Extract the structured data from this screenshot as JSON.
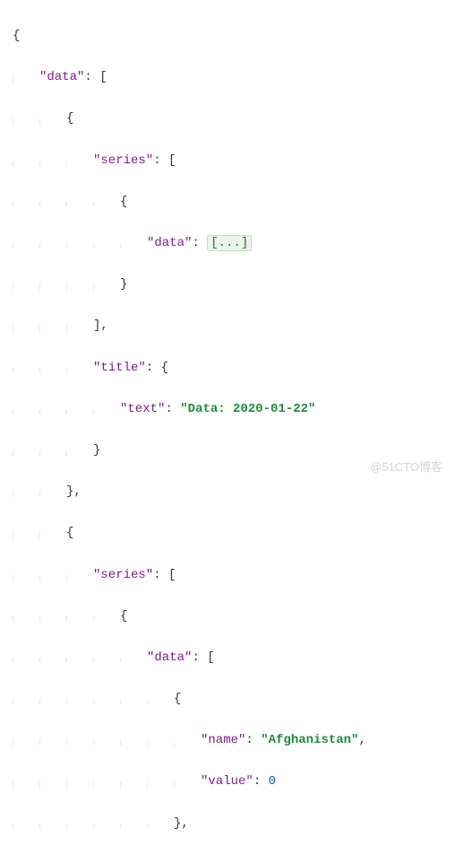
{
  "keys": {
    "data": "\"data\"",
    "series": "\"series\"",
    "title": "\"title\"",
    "text": "\"text\"",
    "name": "\"name\"",
    "value": "\"value\""
  },
  "vals": {
    "date": "\"Data: 2020-01-22\"",
    "afghanistan": "\"Afghanistan\"",
    "zero": "0"
  },
  "punct": {
    "open_brace": "{",
    "close_brace": "}",
    "open_bracket": "[",
    "close_bracket": "]",
    "colon_sp": ": ",
    "comma": ",",
    "close_brace_comma": "},",
    "close_br_comma": "],"
  },
  "fold": "[...]",
  "watermark": "@51CTO博客"
}
